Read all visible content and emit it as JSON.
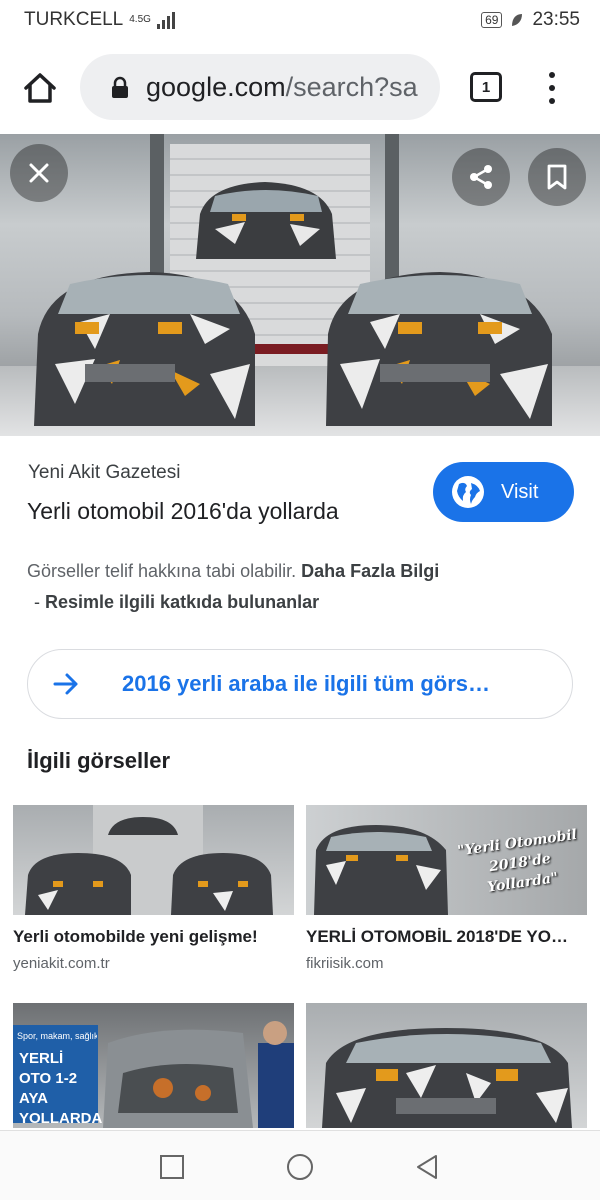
{
  "status_bar": {
    "carrier": "TURKCELL",
    "network": "4.5G",
    "battery": "69",
    "time": "23:55"
  },
  "browser": {
    "url_domain": "google.com",
    "url_path": "/search?sa",
    "tab_count": "1"
  },
  "hero": {
    "close_icon": "close-icon",
    "share_icon": "share-icon",
    "bookmark_icon": "bookmark-icon"
  },
  "result": {
    "source": "Yeni Akit Gazetesi",
    "title": "Yerli otomobil 2016'da yollarda",
    "visit_label": "Visit",
    "copyright_text": "Görseller telif hakkına tabi olabilir.",
    "more_info_link": "Daha Fazla Bilgi",
    "contrib_dash": "-",
    "contrib_link": "Resimle ilgili katkıda bulunanlar"
  },
  "all_images_button": {
    "label": "2016 yerli araba ile ilgili tüm görse…"
  },
  "related": {
    "heading": "İlgili görseller",
    "items": [
      {
        "title": "Yerli otomobilde yeni gelişme!",
        "site": "yeniakit.com.tr"
      },
      {
        "title": "YERLİ OTOMOBİL 2018'DE YO…",
        "site": "fikriisik.com",
        "overlay": "\"Yerli Otomobil 2018'de Yollarda\""
      },
      {
        "title": "",
        "site": "",
        "overlay_top": "Spor, makam, sağlık",
        "overlay": "YERLİ OTO 1-2 AYA YOLLARDA"
      },
      {
        "title": "",
        "site": ""
      }
    ]
  },
  "colors": {
    "accent": "#1a73e8",
    "text_primary": "#202124",
    "text_secondary": "#5f6368"
  }
}
